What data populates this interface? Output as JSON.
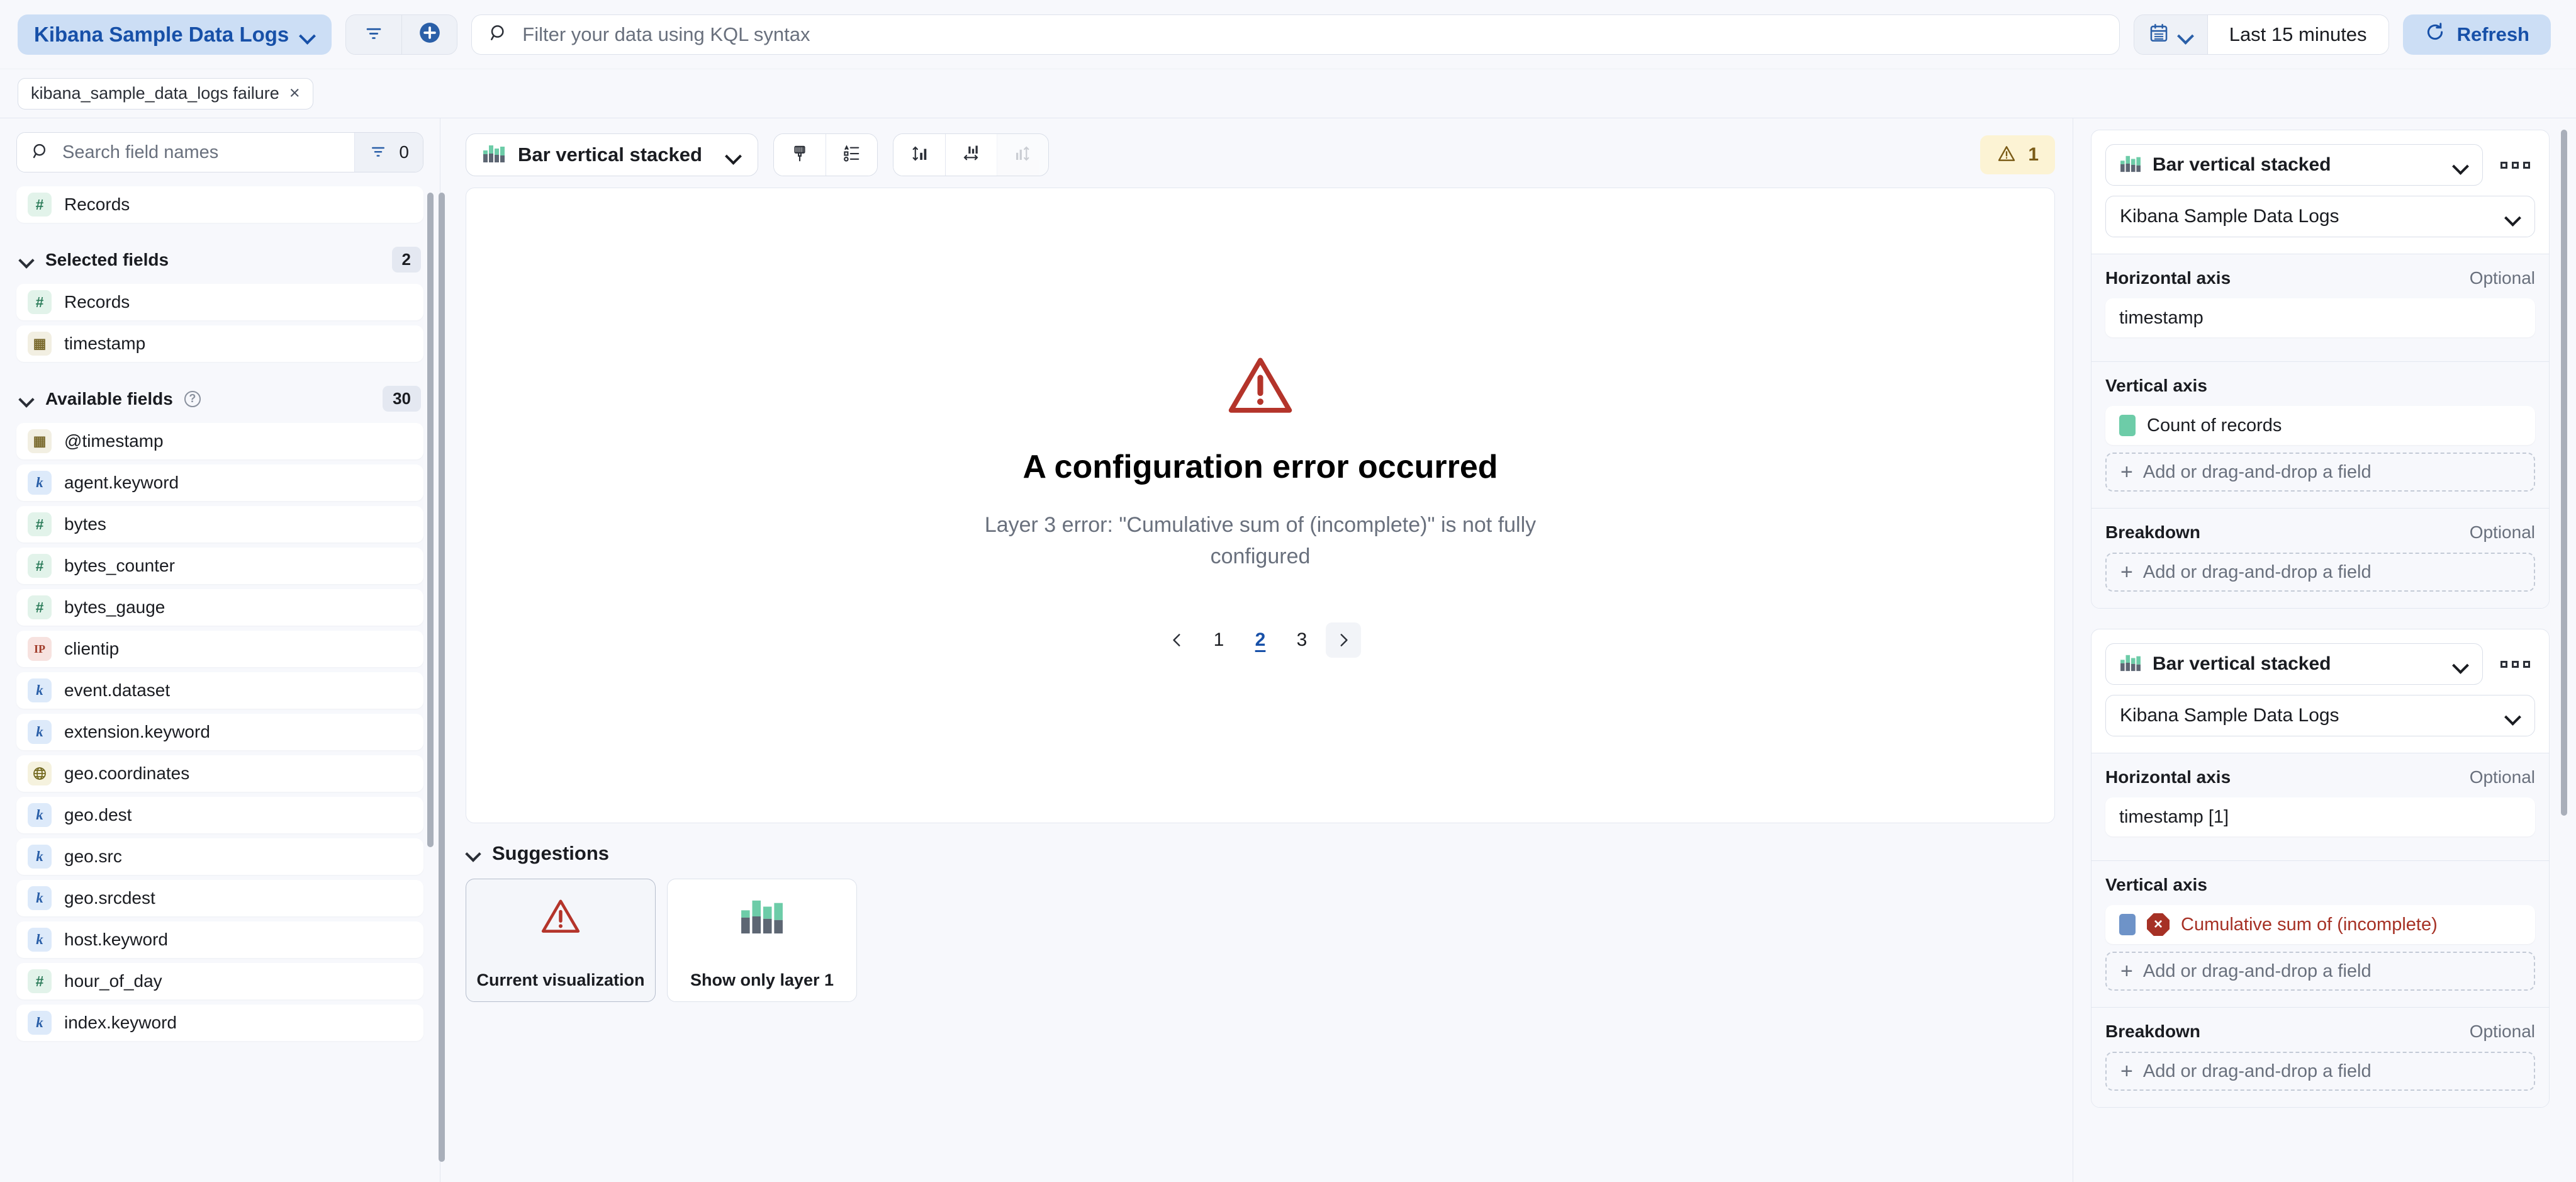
{
  "topbar": {
    "datasource_label": "Kibana Sample Data Logs",
    "filter_icon": "filter-icon",
    "add_filter_icon": "add-circle-icon",
    "search_placeholder": "Filter your data using KQL syntax",
    "search_value": "",
    "search_icon": "search-icon",
    "calendar_icon": "calendar-icon",
    "time_range": "Last 15 minutes",
    "refresh_label": "Refresh",
    "refresh_icon": "refresh-icon"
  },
  "filterbar": {
    "filters": [
      {
        "label": "kibana_sample_data_logs failure",
        "remove": "×"
      }
    ]
  },
  "sidebar": {
    "search_placeholder": "Search field names",
    "search_value": "",
    "filter_button_count": "0",
    "special_field": {
      "label": "Records",
      "type": "number",
      "glyph": "#"
    },
    "groups": [
      {
        "title": "Selected fields",
        "count": "2",
        "fields": [
          {
            "label": "Records",
            "type": "number",
            "glyph": "#"
          },
          {
            "label": "timestamp",
            "type": "date",
            "glyph": "▦"
          }
        ]
      },
      {
        "title": "Available fields",
        "count": "30",
        "has_help": true,
        "fields": [
          {
            "label": "@timestamp",
            "type": "date",
            "glyph": "▦"
          },
          {
            "label": "agent.keyword",
            "type": "string",
            "glyph": "k"
          },
          {
            "label": "bytes",
            "type": "number",
            "glyph": "#"
          },
          {
            "label": "bytes_counter",
            "type": "number",
            "glyph": "#"
          },
          {
            "label": "bytes_gauge",
            "type": "number",
            "glyph": "#"
          },
          {
            "label": "clientip",
            "type": "ip",
            "glyph": "IP"
          },
          {
            "label": "event.dataset",
            "type": "string",
            "glyph": "k"
          },
          {
            "label": "extension.keyword",
            "type": "string",
            "glyph": "k"
          },
          {
            "label": "geo.coordinates",
            "type": "geo",
            "glyph": "⊕"
          },
          {
            "label": "geo.dest",
            "type": "string",
            "glyph": "k"
          },
          {
            "label": "geo.src",
            "type": "string",
            "glyph": "k"
          },
          {
            "label": "geo.srcdest",
            "type": "string",
            "glyph": "k"
          },
          {
            "label": "host.keyword",
            "type": "string",
            "glyph": "k"
          },
          {
            "label": "hour_of_day",
            "type": "number",
            "glyph": "#"
          },
          {
            "label": "index.keyword",
            "type": "string",
            "glyph": "k"
          }
        ]
      }
    ]
  },
  "center": {
    "toolbar": {
      "chart_type": "Bar vertical stacked",
      "buttons": [
        {
          "name": "appearance-brush-icon",
          "disabled": false
        },
        {
          "name": "legend-list-icon",
          "disabled": false
        },
        {
          "name": "vertical-axis-icon",
          "disabled": false
        },
        {
          "name": "horizontal-axis-icon",
          "disabled": false
        },
        {
          "name": "right-axis-icon",
          "disabled": true
        }
      ],
      "warning_count": "1",
      "warning_icon": "warning-triangle-icon"
    },
    "error": {
      "icon": "error-triangle-icon",
      "title": "A configuration error occurred",
      "message": "Layer 3 error: \"Cumulative sum of (incomplete)\" is not fully configured"
    },
    "pagination": {
      "prev_icon": "chevron-left-icon",
      "next_icon": "chevron-right-icon",
      "pages": [
        "1",
        "2",
        "3"
      ],
      "active": "2"
    },
    "suggestions": {
      "title": "Suggestions",
      "items": [
        {
          "label": "Current visualization",
          "icon": "error-triangle-icon",
          "selected": true
        },
        {
          "label": "Show only layer 1",
          "icon": "bar-vertical-stacked-icon",
          "selected": false
        }
      ]
    }
  },
  "config": {
    "layers": [
      {
        "chart_type": "Bar vertical stacked",
        "chart_icon": "bar-vertical-stacked-icon",
        "menu_icon": "more-options-icon",
        "datasource": "Kibana Sample Data Logs",
        "sections": [
          {
            "title": "Horizontal axis",
            "optional": "Optional",
            "chips": [
              {
                "label": "timestamp",
                "swatch": null,
                "error": false
              }
            ],
            "empty_label": null
          },
          {
            "title": "Vertical axis",
            "optional": "",
            "chips": [
              {
                "label": "Count of records",
                "swatch": "#6DCCA8",
                "error": false
              }
            ],
            "empty_label": "Add or drag-and-drop a field"
          },
          {
            "title": "Breakdown",
            "optional": "Optional",
            "chips": [],
            "empty_label": "Add or drag-and-drop a field"
          }
        ]
      },
      {
        "chart_type": "Bar vertical stacked",
        "chart_icon": "bar-vertical-stacked-icon",
        "menu_icon": "more-options-icon",
        "datasource": "Kibana Sample Data Logs",
        "sections": [
          {
            "title": "Horizontal axis",
            "optional": "Optional",
            "chips": [
              {
                "label": "timestamp [1]",
                "swatch": null,
                "error": false
              }
            ],
            "empty_label": null
          },
          {
            "title": "Vertical axis",
            "optional": "",
            "chips": [
              {
                "label": "Cumulative sum of (incomplete)",
                "swatch": "#6E93C8",
                "error": true
              }
            ],
            "empty_label": "Add or drag-and-drop a field"
          },
          {
            "title": "Breakdown",
            "optional": "Optional",
            "chips": [],
            "empty_label": "Add or drag-and-drop a field"
          }
        ]
      }
    ]
  },
  "colors": {
    "accent": "#1750A8",
    "danger": "#A63125",
    "warning_bg": "#FCF3D4",
    "warning_fg": "#7A5B16",
    "series_green": "#6DCCA8",
    "series_blue": "#6E93C8",
    "bg": "#F7F8FC"
  }
}
